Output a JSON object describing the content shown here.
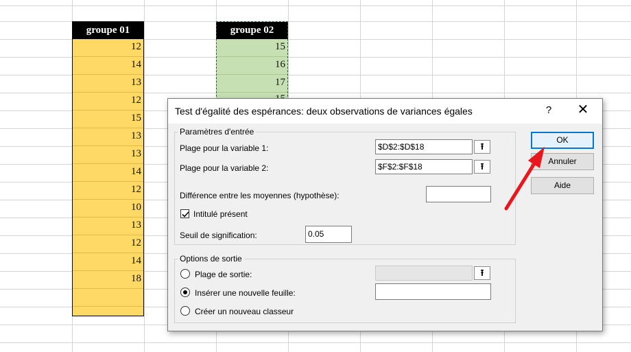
{
  "sheet": {
    "col_d_header": "groupe 01",
    "col_d_values": [
      "12",
      "14",
      "13",
      "12",
      "15",
      "13",
      "13",
      "14",
      "12",
      "10",
      "13",
      "12",
      "14",
      "18",
      "",
      ""
    ],
    "col_f_header": "groupe 02",
    "col_f_values": [
      "15",
      "16",
      "17",
      "15"
    ]
  },
  "dialog": {
    "title": "Test d'égalité des espérances: deux observations de variances égales",
    "help_label": "?",
    "close_label": "✕",
    "input_group": {
      "legend": "Paramètres d'entrée",
      "var1_label": "Plage pour la variable 1:",
      "var1_value": "$D$2:$D$18",
      "var2_label": "Plage pour la variable 2:",
      "var2_value": "$F$2:$F$18",
      "diff_label": "Différence entre les moyennes (hypothèse):",
      "diff_value": "",
      "labels_label": "Intitulé présent",
      "labels_checked": true,
      "alpha_label": "Seuil de signification:",
      "alpha_value": "0.05"
    },
    "output_group": {
      "legend": "Options de sortie",
      "output_range_label": "Plage de sortie:",
      "new_sheet_label": "Insérer une nouvelle feuille:",
      "new_workbook_label": "Créer un nouveau classeur",
      "selected": "new_sheet"
    },
    "buttons": {
      "ok": "OK",
      "cancel": "Annuler",
      "help": "Aide"
    },
    "ref_icon": "⭱"
  },
  "annotation": {
    "arrow_color": "#e8171e"
  }
}
